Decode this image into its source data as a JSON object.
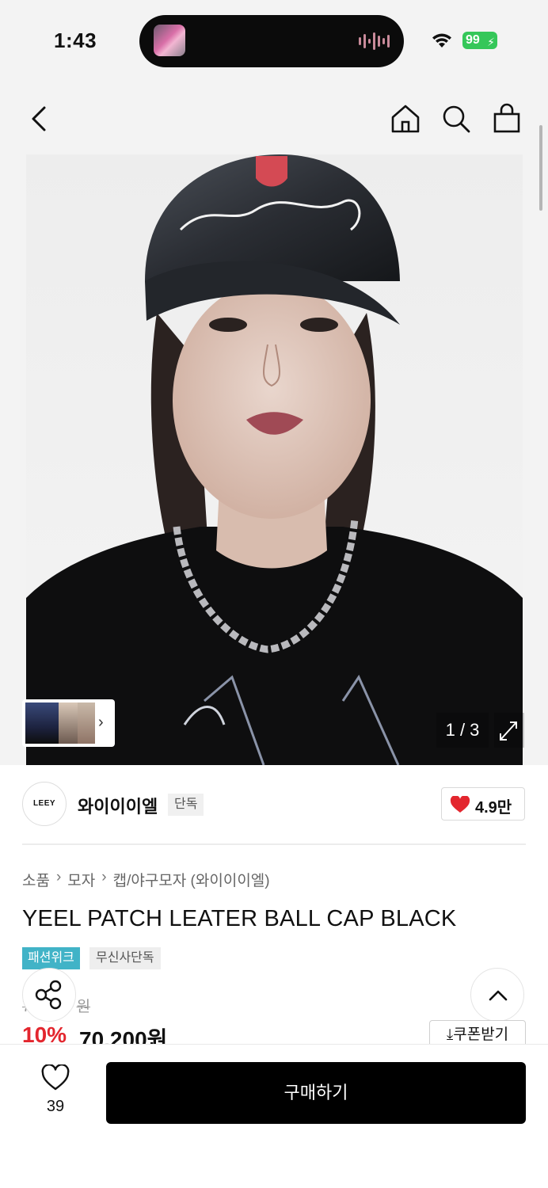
{
  "status_bar": {
    "time": "1:43",
    "battery": "99",
    "colors": {
      "battery": "#35c759"
    },
    "icons": [
      "wifi-icon",
      "battery-icon",
      "audio-wave-icon"
    ]
  },
  "navigation": {
    "icons": [
      "back-chevron-icon",
      "home-icon",
      "search-icon",
      "shopping-bag-icon"
    ]
  },
  "gallery": {
    "counter": "1 / 3",
    "icons": [
      "expand-icon",
      "chevron-right-icon"
    ]
  },
  "brand": {
    "logo_text": "LEEY",
    "name": "와이이이엘",
    "badge": "단독",
    "like_count": "4.9만"
  },
  "breadcrumb": [
    "소품",
    "모자",
    "캡/야구모자 (와이이이엘)"
  ],
  "product": {
    "title": "YEEL PATCH LEATER BALL CAP BLACK",
    "tags": [
      "패션위크",
      "무신사단독"
    ],
    "original_price_partial": "원",
    "discount": "10%",
    "sale_price": "70,200원",
    "coupon_label": "쿠폰받기"
  },
  "bottom_bar": {
    "wish_count": "39",
    "buy_label": "구매하기"
  },
  "colors": {
    "discount_red": "#e3262e",
    "tag_teal": "#41b3c7",
    "like_heart": "#e3262e",
    "buy_button": "#000000"
  }
}
